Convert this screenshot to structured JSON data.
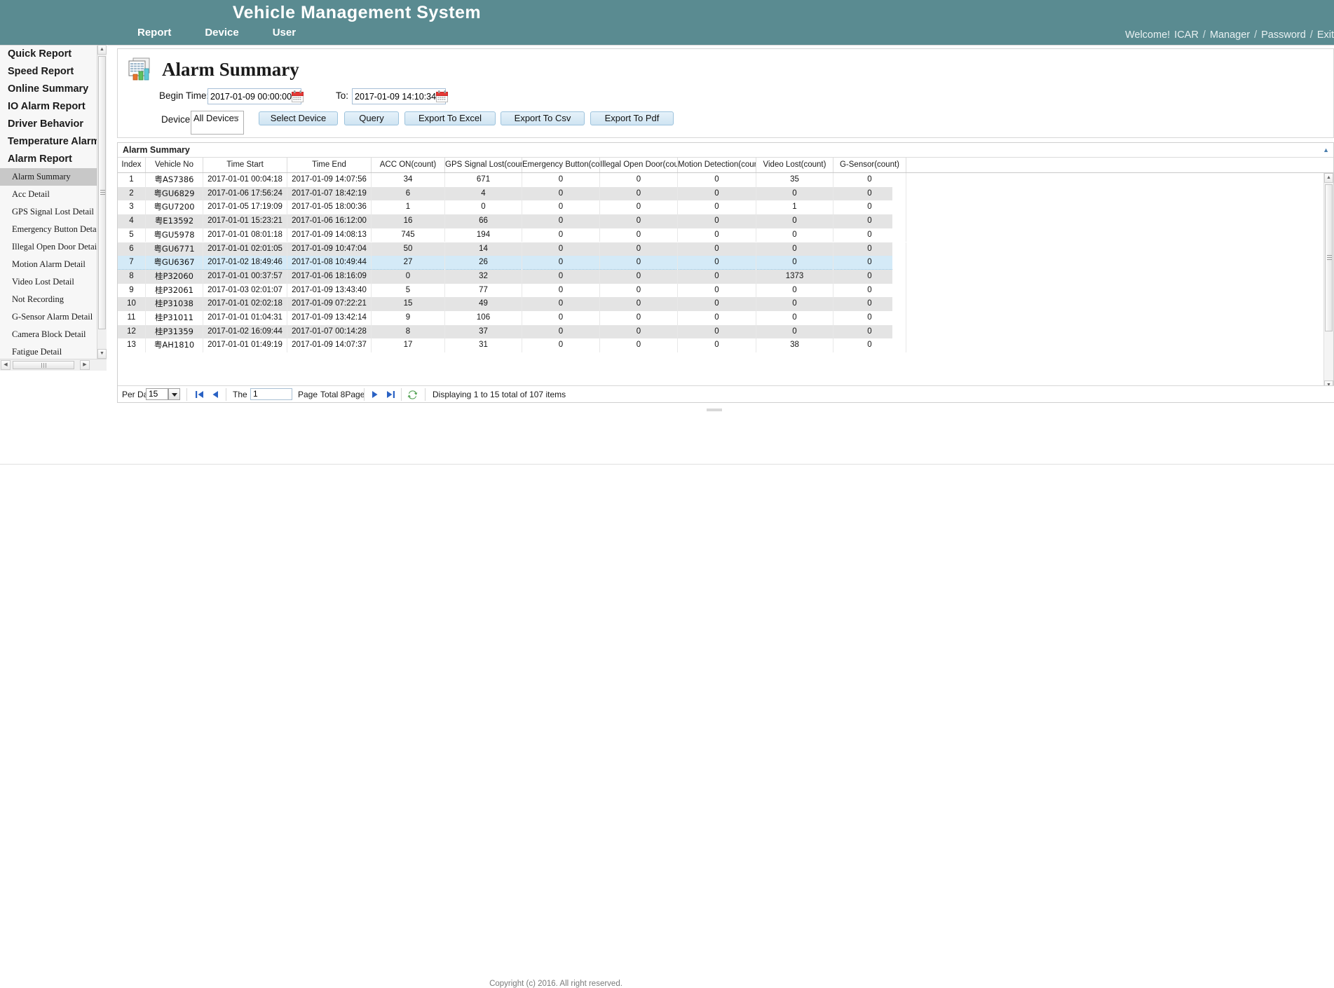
{
  "header": {
    "title": "Vehicle Management System",
    "nav": [
      {
        "label": "Report"
      },
      {
        "label": "Device"
      },
      {
        "label": "User"
      }
    ],
    "account": {
      "welcome": "Welcome!",
      "user": "ICAR",
      "role": "Manager",
      "password": "Password",
      "exit": "Exit",
      "separator": "/"
    }
  },
  "sidebar": {
    "groups": [
      {
        "label": "Quick Report"
      },
      {
        "label": "Speed Report"
      },
      {
        "label": "Online Summary"
      },
      {
        "label": "IO Alarm Report"
      },
      {
        "label": "Driver Behavior"
      },
      {
        "label": "Temperature Alarm"
      },
      {
        "label": "Alarm Report"
      }
    ],
    "items": [
      {
        "label": "Alarm Summary",
        "active": true
      },
      {
        "label": "Acc Detail",
        "active": false
      },
      {
        "label": "GPS Signal Lost Detail",
        "active": false
      },
      {
        "label": "Emergency Button Detail",
        "active": false
      },
      {
        "label": "Illegal Open Door Detail",
        "active": false
      },
      {
        "label": "Motion Alarm Detail",
        "active": false
      },
      {
        "label": "Video Lost Detail",
        "active": false
      },
      {
        "label": "Not Recording",
        "active": false
      },
      {
        "label": "G-Sensor Alarm Detail",
        "active": false
      },
      {
        "label": "Camera Block Detail",
        "active": false
      },
      {
        "label": "Fatigue Detail",
        "active": false
      }
    ]
  },
  "page": {
    "heading": "Alarm Summary",
    "icon": "report-chart-icon"
  },
  "form": {
    "begin_label": "Begin Time:",
    "begin_value": "2017-01-09 00:00:00",
    "to_label": "To:",
    "to_value": "2017-01-09 14:10:34",
    "device_label": "Device:",
    "device_value": "All Devices",
    "calendar_icon": "calendar-icon",
    "buttons": [
      {
        "label": "Select Device"
      },
      {
        "label": "Query"
      },
      {
        "label": "Export To Excel"
      },
      {
        "label": "Export To Csv"
      },
      {
        "label": "Export To Pdf"
      }
    ]
  },
  "grid": {
    "title": "Alarm Summary",
    "collapse_icon": "collapse-up-icon",
    "columns": [
      "Index",
      "Vehicle No",
      "Time Start",
      "Time End",
      "ACC ON(count)",
      "GPS Signal Lost(count)",
      "Emergency Button(count)",
      "Illegal Open Door(count)",
      "Motion Detection(count)",
      "Video Lost(count)",
      "G-Sensor(count)"
    ],
    "rows": [
      {
        "index": "1",
        "vehicle": "粤AS7386",
        "start": "2017-01-01 00:04:18",
        "end": "2017-01-09 14:07:56",
        "acc": "34",
        "gps": "671",
        "emg": "0",
        "door": "0",
        "motion": "0",
        "video": "35",
        "gsensor": "0",
        "selected": false
      },
      {
        "index": "2",
        "vehicle": "粤GU6829",
        "start": "2017-01-06 17:56:24",
        "end": "2017-01-07 18:42:19",
        "acc": "6",
        "gps": "4",
        "emg": "0",
        "door": "0",
        "motion": "0",
        "video": "0",
        "gsensor": "0",
        "selected": false
      },
      {
        "index": "3",
        "vehicle": "粤GU7200",
        "start": "2017-01-05 17:19:09",
        "end": "2017-01-05 18:00:36",
        "acc": "1",
        "gps": "0",
        "emg": "0",
        "door": "0",
        "motion": "0",
        "video": "1",
        "gsensor": "0",
        "selected": false
      },
      {
        "index": "4",
        "vehicle": "粤E13592",
        "start": "2017-01-01 15:23:21",
        "end": "2017-01-06 16:12:00",
        "acc": "16",
        "gps": "66",
        "emg": "0",
        "door": "0",
        "motion": "0",
        "video": "0",
        "gsensor": "0",
        "selected": false
      },
      {
        "index": "5",
        "vehicle": "粤GU5978",
        "start": "2017-01-01 08:01:18",
        "end": "2017-01-09 14:08:13",
        "acc": "745",
        "gps": "194",
        "emg": "0",
        "door": "0",
        "motion": "0",
        "video": "0",
        "gsensor": "0",
        "selected": false
      },
      {
        "index": "6",
        "vehicle": "粤GU6771",
        "start": "2017-01-01 02:01:05",
        "end": "2017-01-09 10:47:04",
        "acc": "50",
        "gps": "14",
        "emg": "0",
        "door": "0",
        "motion": "0",
        "video": "0",
        "gsensor": "0",
        "selected": false
      },
      {
        "index": "7",
        "vehicle": "粤GU6367",
        "start": "2017-01-02 18:49:46",
        "end": "2017-01-08 10:49:44",
        "acc": "27",
        "gps": "26",
        "emg": "0",
        "door": "0",
        "motion": "0",
        "video": "0",
        "gsensor": "0",
        "selected": true
      },
      {
        "index": "8",
        "vehicle": "桂P32060",
        "start": "2017-01-01 00:37:57",
        "end": "2017-01-06 18:16:09",
        "acc": "0",
        "gps": "32",
        "emg": "0",
        "door": "0",
        "motion": "0",
        "video": "1373",
        "gsensor": "0",
        "selected": false
      },
      {
        "index": "9",
        "vehicle": "桂P32061",
        "start": "2017-01-03 02:01:07",
        "end": "2017-01-09 13:43:40",
        "acc": "5",
        "gps": "77",
        "emg": "0",
        "door": "0",
        "motion": "0",
        "video": "0",
        "gsensor": "0",
        "selected": false
      },
      {
        "index": "10",
        "vehicle": "桂P31038",
        "start": "2017-01-01 02:02:18",
        "end": "2017-01-09 07:22:21",
        "acc": "15",
        "gps": "49",
        "emg": "0",
        "door": "0",
        "motion": "0",
        "video": "0",
        "gsensor": "0",
        "selected": false
      },
      {
        "index": "11",
        "vehicle": "桂P31011",
        "start": "2017-01-01 01:04:31",
        "end": "2017-01-09 13:42:14",
        "acc": "9",
        "gps": "106",
        "emg": "0",
        "door": "0",
        "motion": "0",
        "video": "0",
        "gsensor": "0",
        "selected": false
      },
      {
        "index": "12",
        "vehicle": "桂P31359",
        "start": "2017-01-02 16:09:44",
        "end": "2017-01-07 00:14:28",
        "acc": "8",
        "gps": "37",
        "emg": "0",
        "door": "0",
        "motion": "0",
        "video": "0",
        "gsensor": "0",
        "selected": false
      },
      {
        "index": "13",
        "vehicle": "粤AH1810",
        "start": "2017-01-01 01:49:19",
        "end": "2017-01-09 14:07:37",
        "acc": "17",
        "gps": "31",
        "emg": "0",
        "door": "0",
        "motion": "0",
        "video": "38",
        "gsensor": "0",
        "selected": false
      }
    ]
  },
  "pager": {
    "per_data_label": "Per Data",
    "per_data_value": "15",
    "first_icon": "first-page-icon",
    "prev_icon": "prev-page-icon",
    "next_icon": "next-page-icon",
    "last_icon": "last-page-icon",
    "refresh_icon": "refresh-icon",
    "the_label": "The",
    "page_value": "1",
    "page_label": "Page",
    "total_label": "Total 8Page",
    "status": "Displaying 1 to 15 total of 107 items"
  },
  "footer": {
    "copyright": "Copyright (c) 2016. All right reserved."
  },
  "colors": {
    "brand": "#5a8b91",
    "selected_row": "#d4eaf7",
    "stripe_row": "#e4e4e4",
    "button_face": "#cfe4f2",
    "nav_arrow": "#2a62c4",
    "refresh_green": "#4fa04f"
  }
}
